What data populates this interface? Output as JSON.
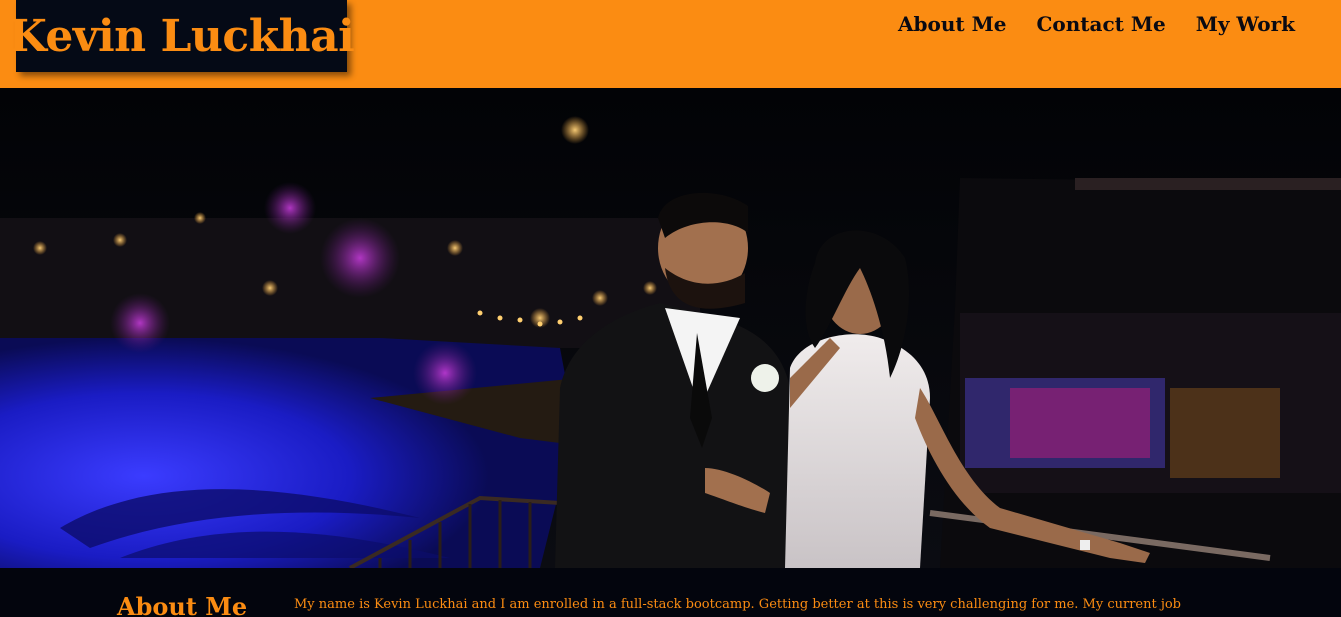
{
  "brand": {
    "name": "Kevin Luckhai"
  },
  "nav": {
    "items": [
      {
        "label": "About Me"
      },
      {
        "label": "Contact Me"
      },
      {
        "label": "My Work"
      }
    ]
  },
  "hero": {
    "image": "couple-portrait-night-pool-photo"
  },
  "about": {
    "heading": "About Me",
    "text": "My name is Kevin Luckhai and I am enrolled in a full-stack bootcamp. Getting better at this is very challenging for me. My current job"
  },
  "colors": {
    "accent": "#fb8c12",
    "dark": "#050a16",
    "nav_text": "#0a0a12"
  }
}
